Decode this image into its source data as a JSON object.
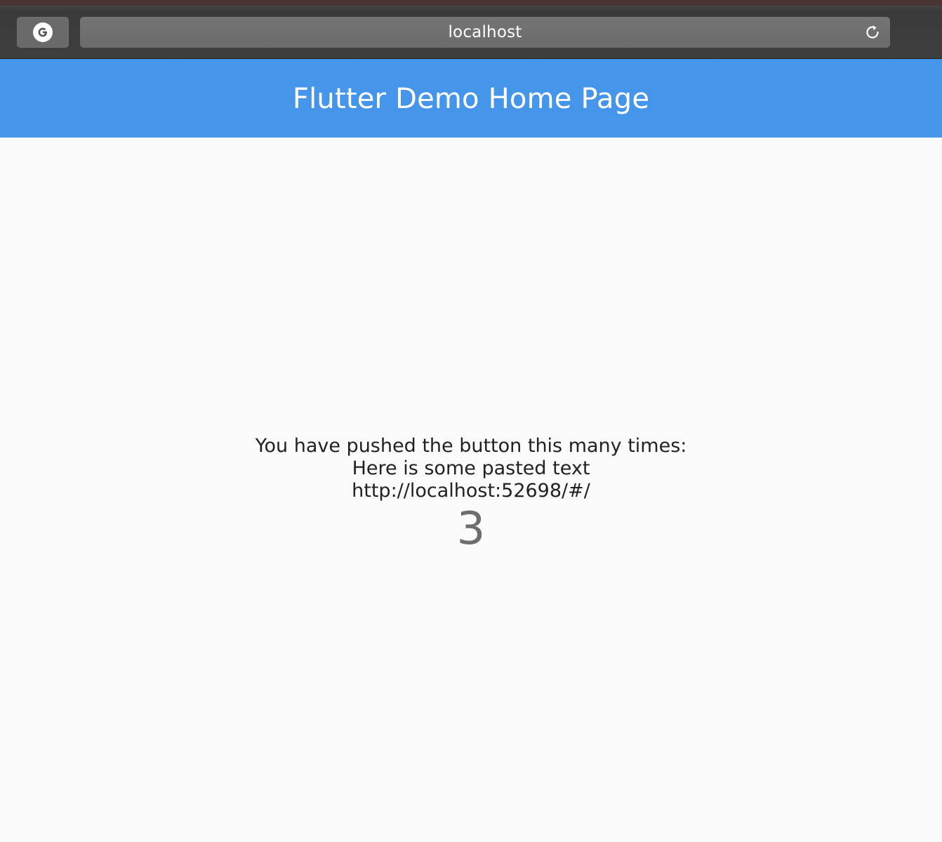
{
  "browser": {
    "address": "localhost"
  },
  "app_bar": {
    "title": "Flutter Demo Home Page",
    "color": "#4596eb"
  },
  "body": {
    "line1": "You have pushed the button this many times:",
    "line2": "Here is some pasted text",
    "line3": "http://localhost:52698/#/",
    "counter": "3"
  },
  "icons": {
    "left_button": "google-g-icon",
    "reload": "reload-icon"
  }
}
